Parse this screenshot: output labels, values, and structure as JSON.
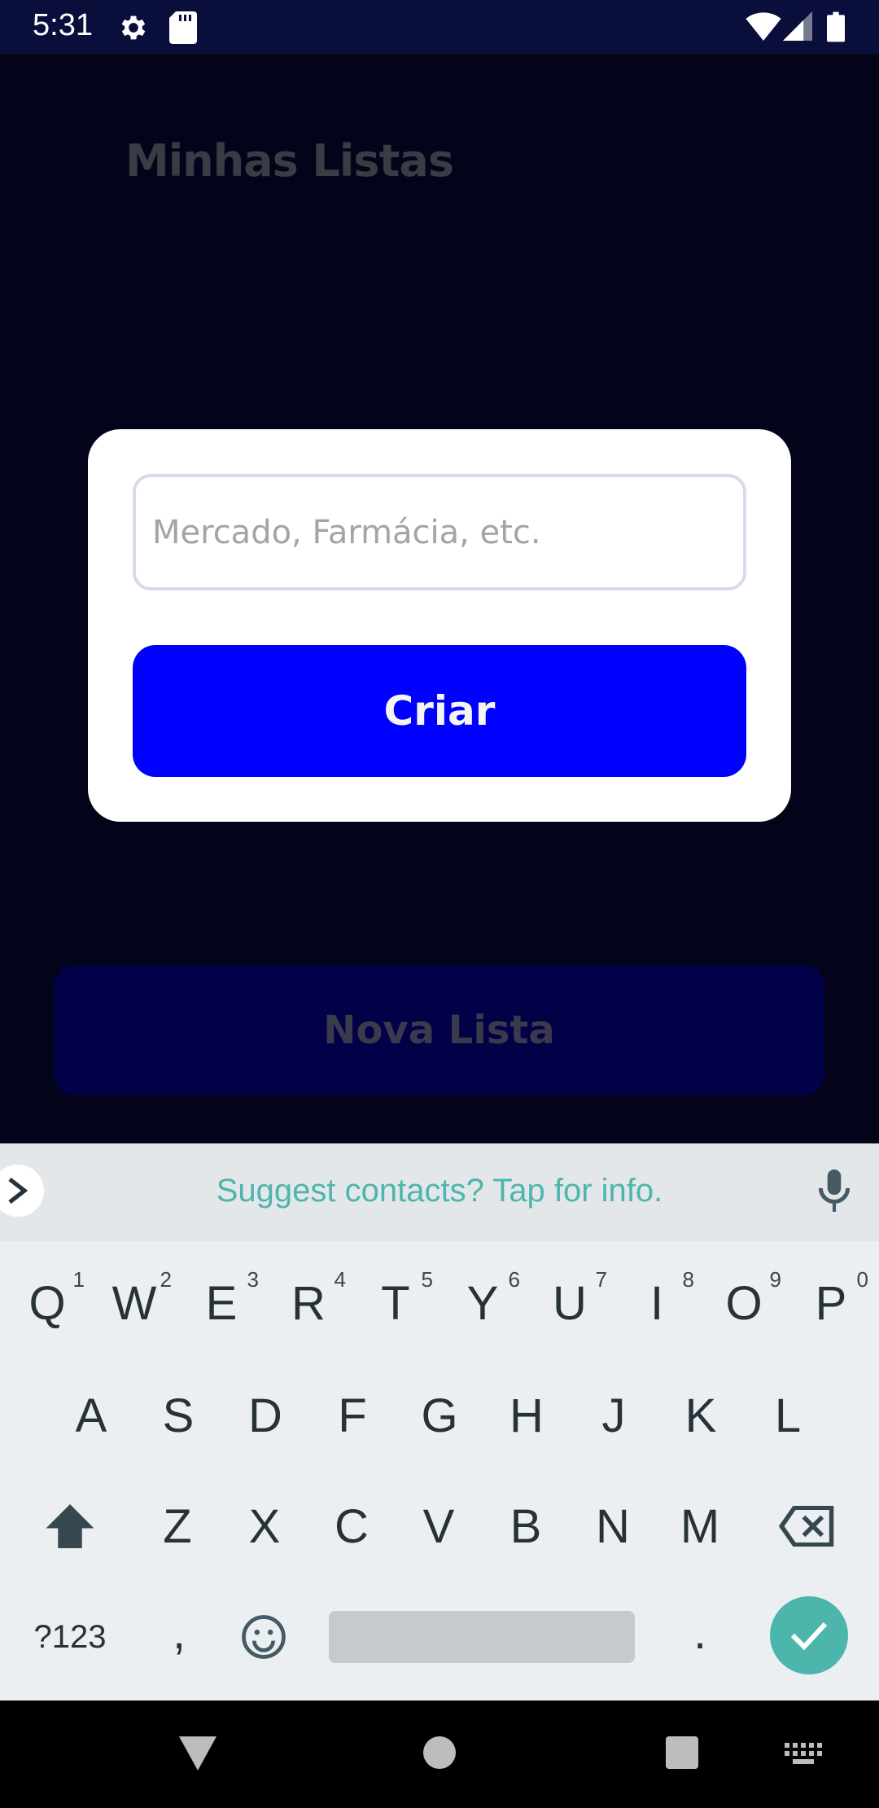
{
  "status_bar": {
    "time": "5:31",
    "icons": [
      "gear-icon",
      "sd-card-icon",
      "wifi-icon",
      "signal-icon",
      "battery-icon"
    ]
  },
  "app": {
    "title": "Minhas Listas",
    "new_list_button": "Nova Lista"
  },
  "dialog": {
    "input_placeholder": "Mercado, Farmácia, etc.",
    "input_value": "",
    "create_button": "Criar"
  },
  "keyboard": {
    "suggestion": "Suggest contacts? Tap for info.",
    "row1": [
      {
        "k": "Q",
        "h": "1"
      },
      {
        "k": "W",
        "h": "2"
      },
      {
        "k": "E",
        "h": "3"
      },
      {
        "k": "R",
        "h": "4"
      },
      {
        "k": "T",
        "h": "5"
      },
      {
        "k": "Y",
        "h": "6"
      },
      {
        "k": "U",
        "h": "7"
      },
      {
        "k": "I",
        "h": "8"
      },
      {
        "k": "O",
        "h": "9"
      },
      {
        "k": "P",
        "h": "0"
      }
    ],
    "row2": [
      "A",
      "S",
      "D",
      "F",
      "G",
      "H",
      "J",
      "K",
      "L"
    ],
    "row3": [
      "Z",
      "X",
      "C",
      "V",
      "B",
      "N",
      "M"
    ],
    "symbols_key": "?123",
    "comma_key": ",",
    "period_key": "."
  },
  "colors": {
    "status_bar": "#0a0e3a",
    "background": "#03041a",
    "primary_button": "#0000ff",
    "keyboard_accent": "#4db6ac"
  }
}
